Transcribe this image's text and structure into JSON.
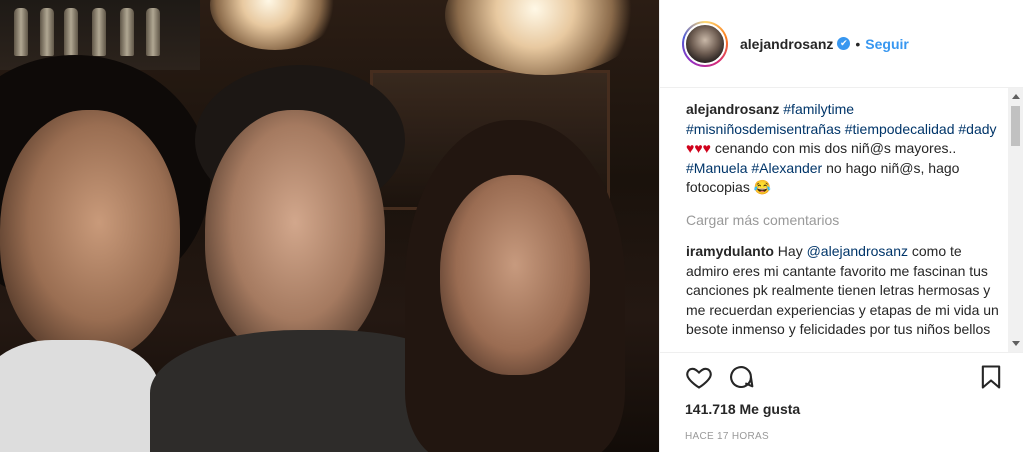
{
  "post": {
    "author": "alejandrosanz",
    "follow_label": "Seguir",
    "dot": "•",
    "verified_mark": "✔"
  },
  "caption": {
    "author": "alejandrosanz",
    "tags_line1": "#familytime",
    "tag2": "#misniñosdemisentrañas",
    "tag3": "#tiempodecalidad",
    "tag4": "#dady",
    "hearts": "♥♥♥",
    "text1": "cenando con mis dos niñ@s mayores..",
    "tag5": "#Manuela",
    "tag6": "#Alexander",
    "text2": "no hago niñ@s, hago fotocopias 😂"
  },
  "load_more": "Cargar más comentarios",
  "comment": {
    "author": "iramydulanto",
    "text_a": "Hay",
    "mention": "@alejandrosanz",
    "text_b": "como te admiro eres mi cantante favorito me fascinan tus canciones pk realmente tienen letras hermosas y me recuerdan experiencias y etapas de mi vida un besote inmenso y felicidades por tus niños bellos"
  },
  "likes_label": "141.718 Me gusta",
  "time_label": "HACE 17 HORAS",
  "icons": {
    "like": "heart-outline-icon",
    "comment": "speech-bubble-icon",
    "save": "bookmark-icon"
  }
}
